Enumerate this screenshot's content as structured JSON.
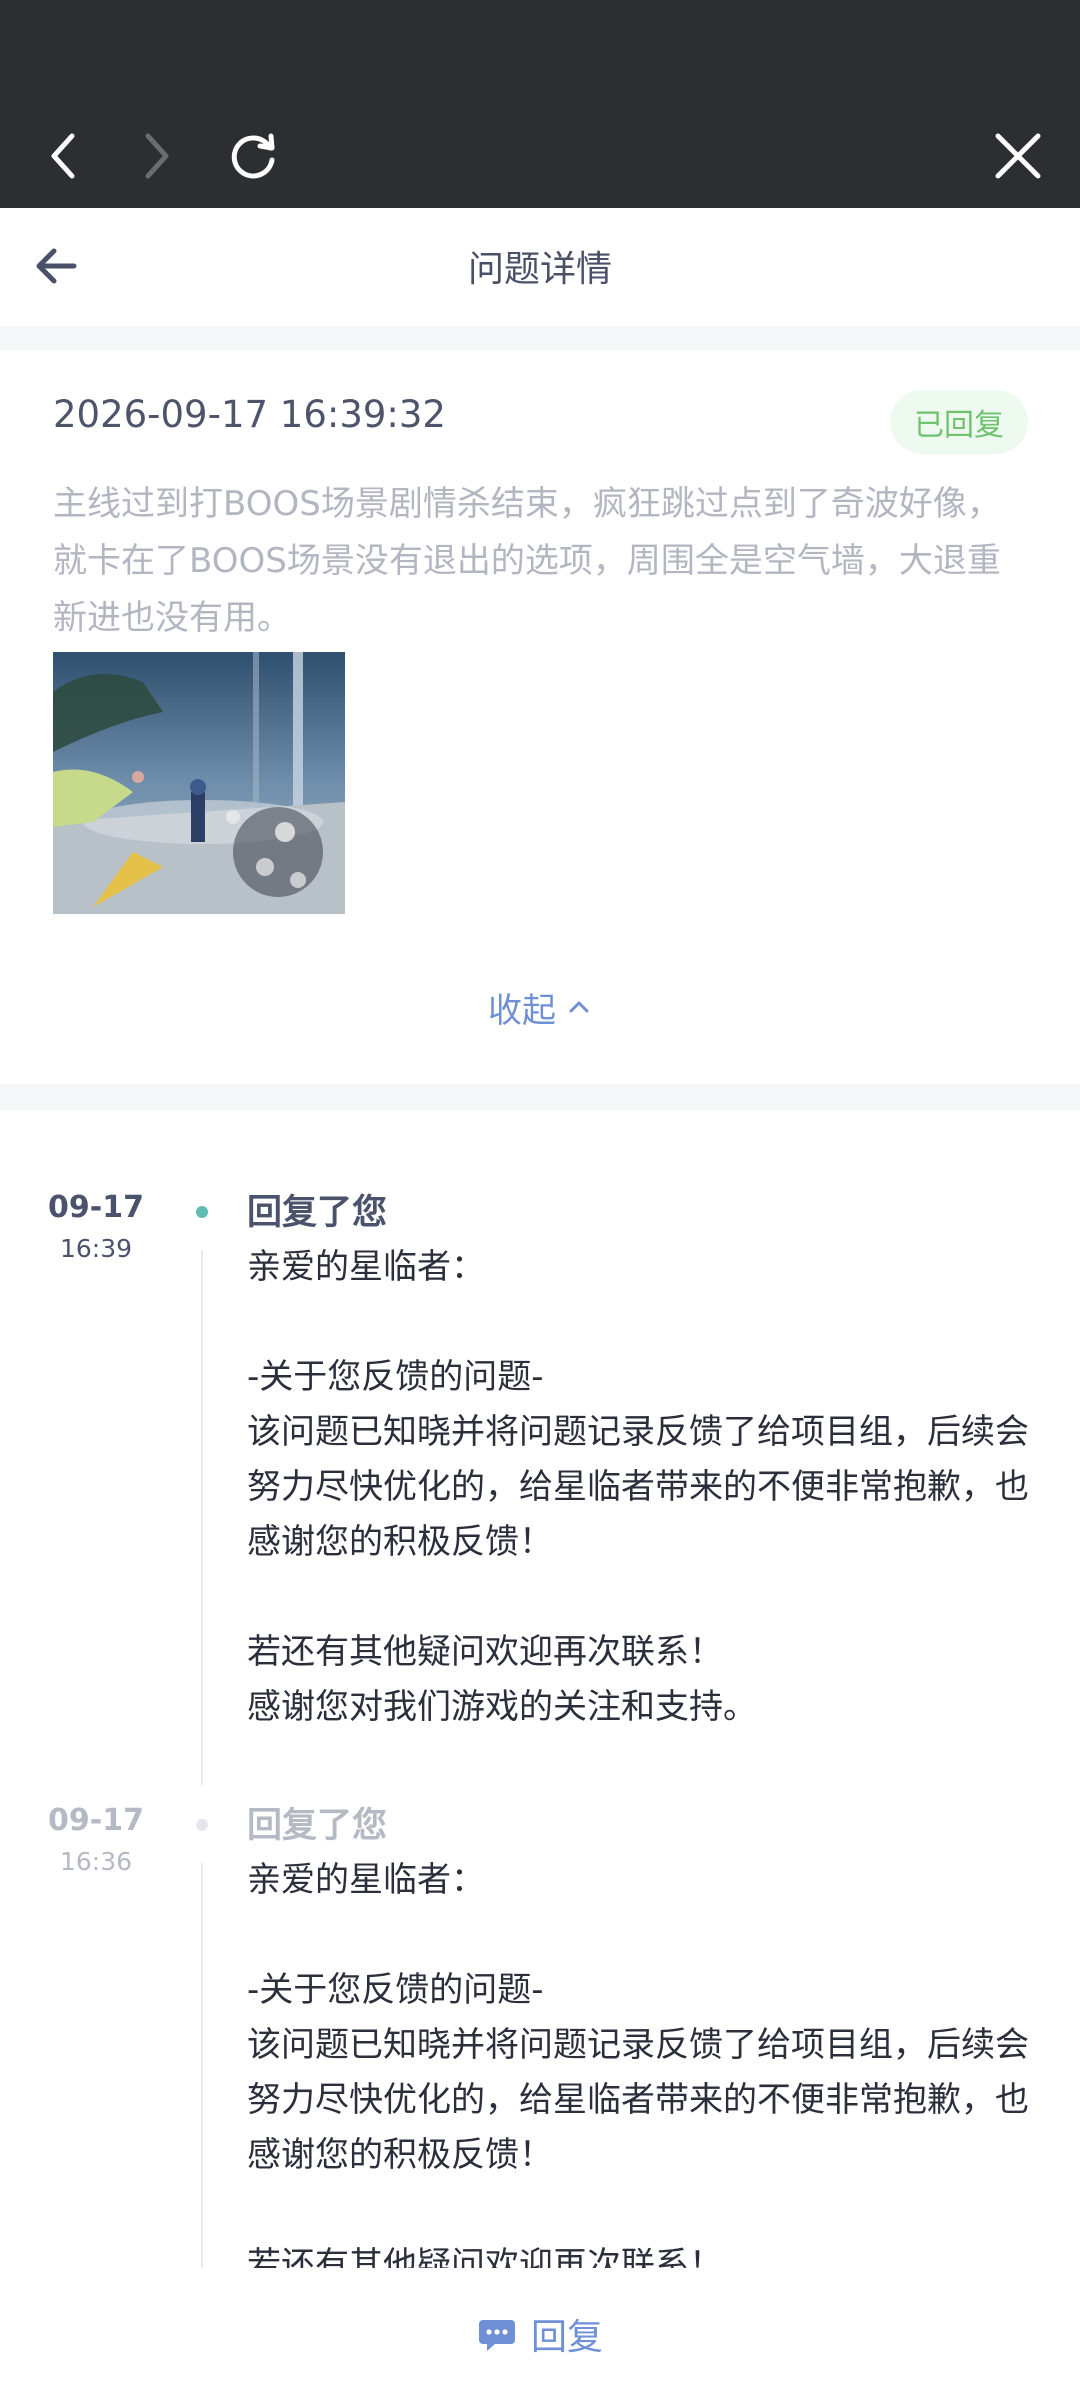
{
  "browser": {
    "icons": [
      "back-icon",
      "forward-icon",
      "refresh-icon",
      "close-icon"
    ]
  },
  "header": {
    "title": "问题详情",
    "back_icon": "arrow-left-icon"
  },
  "feedback": {
    "time": "2026-09-17 16:39:32",
    "status": "已回复",
    "status_color": "#6ec36c",
    "text": "主线过到打BOOS场景剧情杀结束，疯狂跳过点到了奇波好像，就卡在了BOOS场景没有退出的选项，周围全是空气墙，大退重新进也没有用。",
    "collapse_label": "收起"
  },
  "replies": [
    {
      "date": "09-17",
      "time": "16:39",
      "title": "回复了您",
      "lines": [
        "亲爱的星临者：",
        "",
        "-关于您反馈的问题-",
        "该问题已知晓并将问题记录反馈了给项目组，后续会努力尽快优化的，给星临者带来的不便非常抱歉，也感谢您的积极反馈！",
        "",
        "若还有其他疑问欢迎再次联系！",
        "感谢您对我们游戏的关注和支持。"
      ]
    },
    {
      "date": "09-17",
      "time": "16:36",
      "title": "回复了您",
      "lines": [
        "亲爱的星临者：",
        "",
        "-关于您反馈的问题-",
        "该问题已知晓并将问题记录反馈了给项目组，后续会努力尽快优化的，给星临者带来的不便非常抱歉，也感谢您的积极反馈！",
        "",
        "若还有其他疑问欢迎再次联系！"
      ]
    }
  ],
  "footer": {
    "reply_label": "回复",
    "accent": "#6f8fd6"
  }
}
